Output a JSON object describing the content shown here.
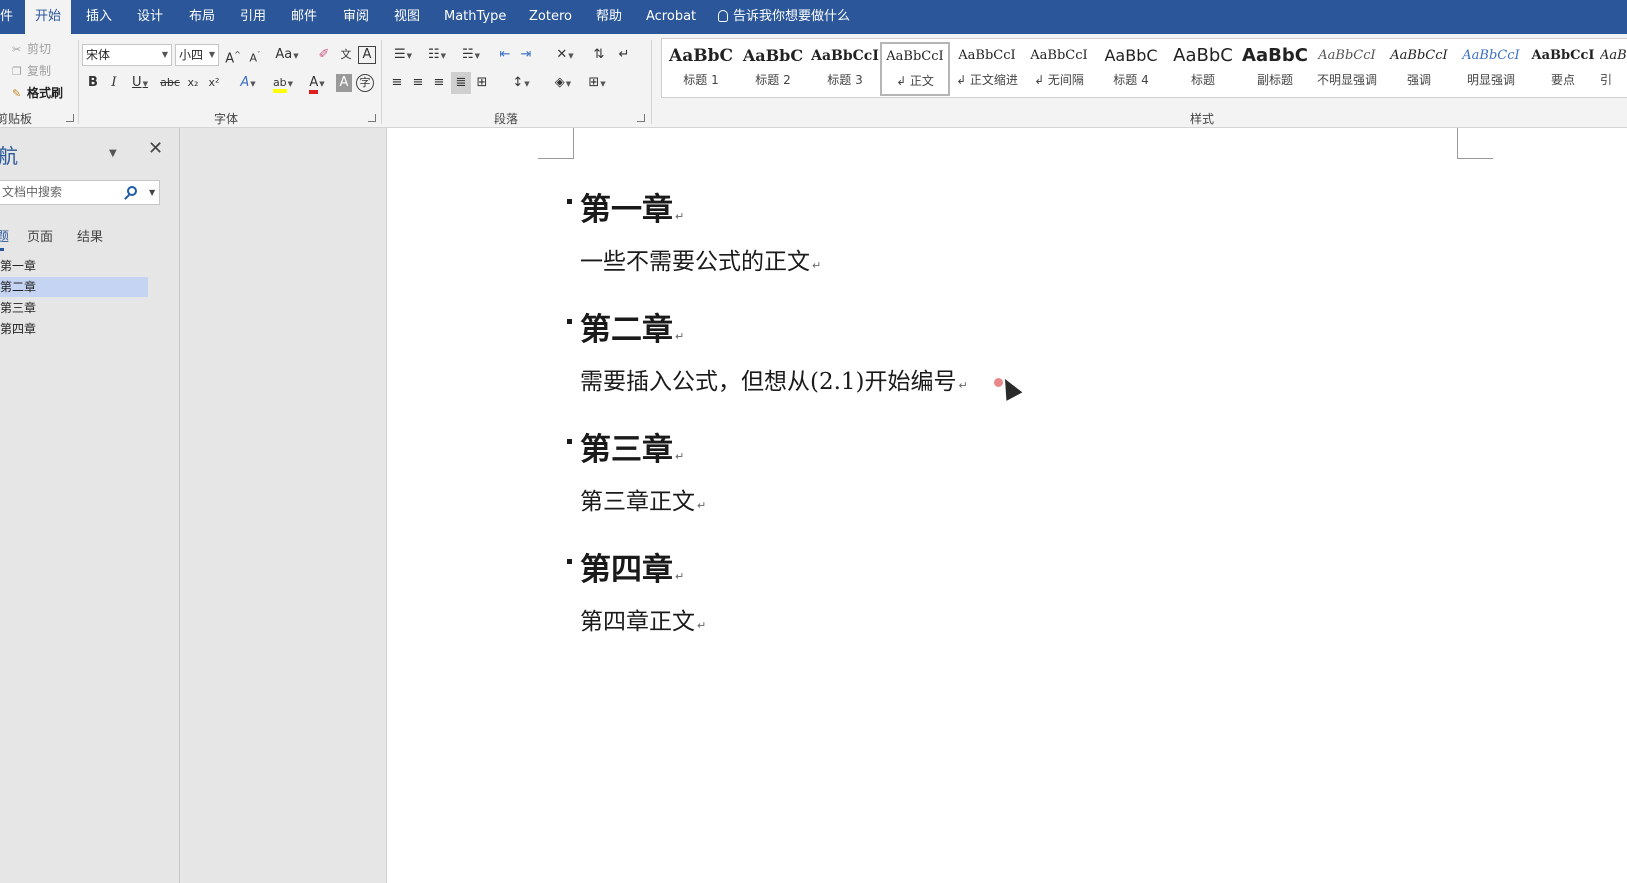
{
  "ribbon_tabs": [
    {
      "label": "件"
    },
    {
      "label": "开始"
    },
    {
      "label": "插入"
    },
    {
      "label": "设计"
    },
    {
      "label": "布局"
    },
    {
      "label": "引用"
    },
    {
      "label": "邮件"
    },
    {
      "label": "审阅"
    },
    {
      "label": "视图"
    },
    {
      "label": "MathType"
    },
    {
      "label": "Zotero"
    },
    {
      "label": "帮助"
    },
    {
      "label": "Acrobat"
    }
  ],
  "tell_me": "告诉我你想要做什么",
  "clipboard": {
    "cut": "剪切",
    "copy": "复制",
    "format_painter": "格式刷",
    "group_label": "剪贴板"
  },
  "font": {
    "font_name": "宋体",
    "font_size": "小四",
    "group_label": "字体",
    "bold": "B",
    "italic": "I",
    "underline": "U",
    "strikethrough": "abc",
    "subscript": "x₂",
    "superscript": "x²",
    "grow": "A",
    "shrink": "A",
    "change_case": "Aa",
    "phonetic": "文",
    "border_char": "A",
    "text_effects": "A",
    "highlight": "ab",
    "font_color": "A",
    "char_shading": "A",
    "enclose": "字"
  },
  "paragraph": {
    "group_label": "段落"
  },
  "styles": {
    "group_label": "样式",
    "items": [
      {
        "preview": "AaBbC",
        "name": "标题 1"
      },
      {
        "preview": "AaBbC",
        "name": "标题 2"
      },
      {
        "preview": "AaBbCcI",
        "name": "标题 3"
      },
      {
        "preview": "AaBbCcI",
        "name": "↲ 正文"
      },
      {
        "preview": "AaBbCcI",
        "name": "↲ 正文缩进"
      },
      {
        "preview": "AaBbCcI",
        "name": "↲ 无间隔"
      },
      {
        "preview": "AaBbC",
        "name": "标题 4"
      },
      {
        "preview": "AaBbC",
        "name": "标题"
      },
      {
        "preview": "AaBbC",
        "name": "副标题"
      },
      {
        "preview": "AaBbCcI",
        "name": "不明显强调"
      },
      {
        "preview": "AaBbCcI",
        "name": "强调"
      },
      {
        "preview": "AaBbCcI",
        "name": "明显强调"
      },
      {
        "preview": "AaBbCcI",
        "name": "要点"
      },
      {
        "preview": "AaB",
        "name": "引"
      }
    ]
  },
  "nav": {
    "title": "航",
    "search_placeholder": "文档中搜索",
    "tabs": [
      "题",
      "页面",
      "结果"
    ],
    "items": [
      "第一章",
      "第二章",
      "第三章",
      "第四章"
    ]
  },
  "document": {
    "sections": [
      {
        "heading": "第一章",
        "body": "一些不需要公式的正文"
      },
      {
        "heading": "第二章",
        "body": "需要插入公式，但想从(2.1)开始编号"
      },
      {
        "heading": "第三章",
        "body": "第三章正文"
      },
      {
        "heading": "第四章",
        "body": "第四章正文"
      }
    ],
    "paragraph_mark": "↵"
  },
  "colors": {
    "accent": "#2b579a",
    "ribbon_bg": "#f3f3f3",
    "nav_selected": "#c5d4f2",
    "highlight_yellow": "#ffff00",
    "font_color_red": "#e02020"
  }
}
